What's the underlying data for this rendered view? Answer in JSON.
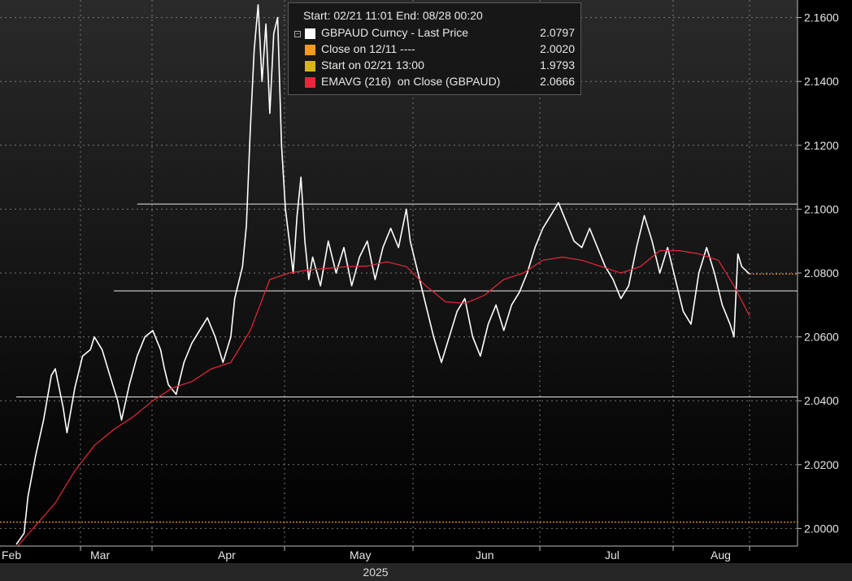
{
  "legend": {
    "header": "Start: 02/21 11:01 End: 08/28 00:20",
    "items": [
      {
        "name": "GBPAUD Curncy - Last Price",
        "value": "2.0797",
        "color": "#ffffff"
      },
      {
        "name": "Close on 12/11 ----",
        "value": "2.0020",
        "color": "#f59a1c"
      },
      {
        "name": "Start on 02/21 13:00",
        "value": "1.9793",
        "color": "#d6b51a"
      },
      {
        "name": "EMAVG (216)  on Close (GBPAUD)",
        "value": "2.0666",
        "color": "#e8283a"
      }
    ]
  },
  "chart_data": {
    "type": "line",
    "x_tick_labels": [
      "Feb",
      "Mar",
      "Apr",
      "May",
      "Jun",
      "Jul",
      "Aug"
    ],
    "year_label": "2025",
    "y_tick_labels": [
      "2.0000",
      "2.0200",
      "2.0400",
      "2.0600",
      "2.0800",
      "2.1000",
      "2.1200",
      "2.1400",
      "2.1600"
    ],
    "ylim": [
      1.9945,
      2.1655
    ],
    "x_domain": [
      "2025-02-21",
      "2025-08-28"
    ],
    "grid": true,
    "legend_position": "top-center",
    "reference_lines": [
      {
        "name": "Close on 12/11",
        "value": 2.002,
        "color": "#f59a1c",
        "style": "dotted"
      },
      {
        "name": "Last Price",
        "value": 2.0797,
        "color": "#f59a1c",
        "style": "dotted",
        "from": "2025-08-28"
      }
    ],
    "horizontal_levels": [
      {
        "value": 2.1016,
        "from": "2025-03-24",
        "to": "2025-08-28"
      },
      {
        "value": 2.0744,
        "from": "2025-03-18",
        "to": "2025-08-28"
      },
      {
        "value": 2.0412,
        "from": "2025-02-21",
        "to": "2025-08-28"
      }
    ],
    "series": [
      {
        "name": "GBPAUD Curncy - Last Price",
        "color": "#ffffff",
        "points": [
          [
            "2025-02-21",
            1.995
          ],
          [
            "2025-02-23",
            1.9985
          ],
          [
            "2025-02-24",
            2.01
          ],
          [
            "2025-02-26",
            2.023
          ],
          [
            "2025-02-28",
            2.034
          ],
          [
            "2025-03-02",
            2.048
          ],
          [
            "2025-03-03",
            2.05
          ],
          [
            "2025-03-05",
            2.038
          ],
          [
            "2025-03-06",
            2.03
          ],
          [
            "2025-03-08",
            2.044
          ],
          [
            "2025-03-10",
            2.054
          ],
          [
            "2025-03-12",
            2.056
          ],
          [
            "2025-03-13",
            2.06
          ],
          [
            "2025-03-15",
            2.056
          ],
          [
            "2025-03-17",
            2.048
          ],
          [
            "2025-03-19",
            2.04
          ],
          [
            "2025-03-20",
            2.034
          ],
          [
            "2025-03-22",
            2.045
          ],
          [
            "2025-03-24",
            2.054
          ],
          [
            "2025-03-26",
            2.06
          ],
          [
            "2025-03-28",
            2.062
          ],
          [
            "2025-03-30",
            2.056
          ],
          [
            "2025-03-31",
            2.05
          ],
          [
            "2025-04-01",
            2.045
          ],
          [
            "2025-04-03",
            2.042
          ],
          [
            "2025-04-05",
            2.052
          ],
          [
            "2025-04-07",
            2.058
          ],
          [
            "2025-04-09",
            2.062
          ],
          [
            "2025-04-11",
            2.066
          ],
          [
            "2025-04-13",
            2.06
          ],
          [
            "2025-04-15",
            2.052
          ],
          [
            "2025-04-17",
            2.06
          ],
          [
            "2025-04-18",
            2.072
          ],
          [
            "2025-04-20",
            2.082
          ],
          [
            "2025-04-21",
            2.095
          ],
          [
            "2025-04-22",
            2.125
          ],
          [
            "2025-04-23",
            2.15
          ],
          [
            "2025-04-24",
            2.164
          ],
          [
            "2025-04-25",
            2.14
          ],
          [
            "2025-04-26",
            2.158
          ],
          [
            "2025-04-27",
            2.13
          ],
          [
            "2025-04-28",
            2.155
          ],
          [
            "2025-04-29",
            2.16
          ],
          [
            "2025-04-30",
            2.12
          ],
          [
            "2025-05-01",
            2.1
          ],
          [
            "2025-05-02",
            2.09
          ],
          [
            "2025-05-03",
            2.08
          ],
          [
            "2025-05-04",
            2.098
          ],
          [
            "2025-05-05",
            2.11
          ],
          [
            "2025-05-06",
            2.09
          ],
          [
            "2025-05-07",
            2.078
          ],
          [
            "2025-05-08",
            2.085
          ],
          [
            "2025-05-10",
            2.076
          ],
          [
            "2025-05-12",
            2.09
          ],
          [
            "2025-05-14",
            2.08
          ],
          [
            "2025-05-16",
            2.088
          ],
          [
            "2025-05-18",
            2.076
          ],
          [
            "2025-05-20",
            2.085
          ],
          [
            "2025-05-22",
            2.09
          ],
          [
            "2025-05-24",
            2.078
          ],
          [
            "2025-05-26",
            2.088
          ],
          [
            "2025-05-28",
            2.094
          ],
          [
            "2025-05-30",
            2.088
          ],
          [
            "2025-06-01",
            2.1
          ],
          [
            "2025-06-02",
            2.09
          ],
          [
            "2025-06-04",
            2.08
          ],
          [
            "2025-06-06",
            2.07
          ],
          [
            "2025-06-08",
            2.06
          ],
          [
            "2025-06-10",
            2.052
          ],
          [
            "2025-06-12",
            2.06
          ],
          [
            "2025-06-14",
            2.068
          ],
          [
            "2025-06-16",
            2.072
          ],
          [
            "2025-06-18",
            2.06
          ],
          [
            "2025-06-20",
            2.054
          ],
          [
            "2025-06-22",
            2.064
          ],
          [
            "2025-06-24",
            2.07
          ],
          [
            "2025-06-26",
            2.062
          ],
          [
            "2025-06-28",
            2.07
          ],
          [
            "2025-06-30",
            2.074
          ],
          [
            "2025-07-02",
            2.08
          ],
          [
            "2025-07-04",
            2.088
          ],
          [
            "2025-07-06",
            2.094
          ],
          [
            "2025-07-08",
            2.098
          ],
          [
            "2025-07-10",
            2.102
          ],
          [
            "2025-07-12",
            2.096
          ],
          [
            "2025-07-14",
            2.09
          ],
          [
            "2025-07-16",
            2.088
          ],
          [
            "2025-07-18",
            2.094
          ],
          [
            "2025-07-20",
            2.088
          ],
          [
            "2025-07-22",
            2.082
          ],
          [
            "2025-07-24",
            2.078
          ],
          [
            "2025-07-26",
            2.072
          ],
          [
            "2025-07-28",
            2.076
          ],
          [
            "2025-07-30",
            2.088
          ],
          [
            "2025-08-01",
            2.098
          ],
          [
            "2025-08-03",
            2.09
          ],
          [
            "2025-08-05",
            2.08
          ],
          [
            "2025-08-07",
            2.088
          ],
          [
            "2025-08-09",
            2.078
          ],
          [
            "2025-08-11",
            2.068
          ],
          [
            "2025-08-13",
            2.064
          ],
          [
            "2025-08-15",
            2.08
          ],
          [
            "2025-08-17",
            2.088
          ],
          [
            "2025-08-19",
            2.08
          ],
          [
            "2025-08-21",
            2.07
          ],
          [
            "2025-08-23",
            2.064
          ],
          [
            "2025-08-24",
            2.06
          ],
          [
            "2025-08-25",
            2.086
          ],
          [
            "2025-08-26",
            2.082
          ],
          [
            "2025-08-28",
            2.0797
          ]
        ]
      },
      {
        "name": "EMAVG (216)  on Close (GBPAUD)",
        "color": "#e8283a",
        "points": [
          [
            "2025-02-21",
            1.994
          ],
          [
            "2025-02-26",
            2.001
          ],
          [
            "2025-03-03",
            2.008
          ],
          [
            "2025-03-08",
            2.018
          ],
          [
            "2025-03-13",
            2.026
          ],
          [
            "2025-03-18",
            2.031
          ],
          [
            "2025-03-23",
            2.035
          ],
          [
            "2025-03-28",
            2.04
          ],
          [
            "2025-04-02",
            2.044
          ],
          [
            "2025-04-07",
            2.046
          ],
          [
            "2025-04-12",
            2.05
          ],
          [
            "2025-04-17",
            2.052
          ],
          [
            "2025-04-22",
            2.062
          ],
          [
            "2025-04-27",
            2.078
          ],
          [
            "2025-05-02",
            2.08
          ],
          [
            "2025-05-07",
            2.081
          ],
          [
            "2025-05-12",
            2.0815
          ],
          [
            "2025-05-17",
            2.082
          ],
          [
            "2025-05-22",
            2.0822
          ],
          [
            "2025-05-27",
            2.0835
          ],
          [
            "2025-06-01",
            2.082
          ],
          [
            "2025-06-06",
            2.076
          ],
          [
            "2025-06-11",
            2.071
          ],
          [
            "2025-06-16",
            2.0705
          ],
          [
            "2025-06-21",
            2.073
          ],
          [
            "2025-06-26",
            2.078
          ],
          [
            "2025-07-01",
            2.08
          ],
          [
            "2025-07-06",
            2.084
          ],
          [
            "2025-07-11",
            2.085
          ],
          [
            "2025-07-16",
            2.084
          ],
          [
            "2025-07-21",
            2.082
          ],
          [
            "2025-07-26",
            2.08
          ],
          [
            "2025-07-31",
            2.082
          ],
          [
            "2025-08-05",
            2.087
          ],
          [
            "2025-08-10",
            2.087
          ],
          [
            "2025-08-15",
            2.086
          ],
          [
            "2025-08-20",
            2.084
          ],
          [
            "2025-08-24",
            2.076
          ],
          [
            "2025-08-28",
            2.0666
          ]
        ]
      }
    ]
  }
}
